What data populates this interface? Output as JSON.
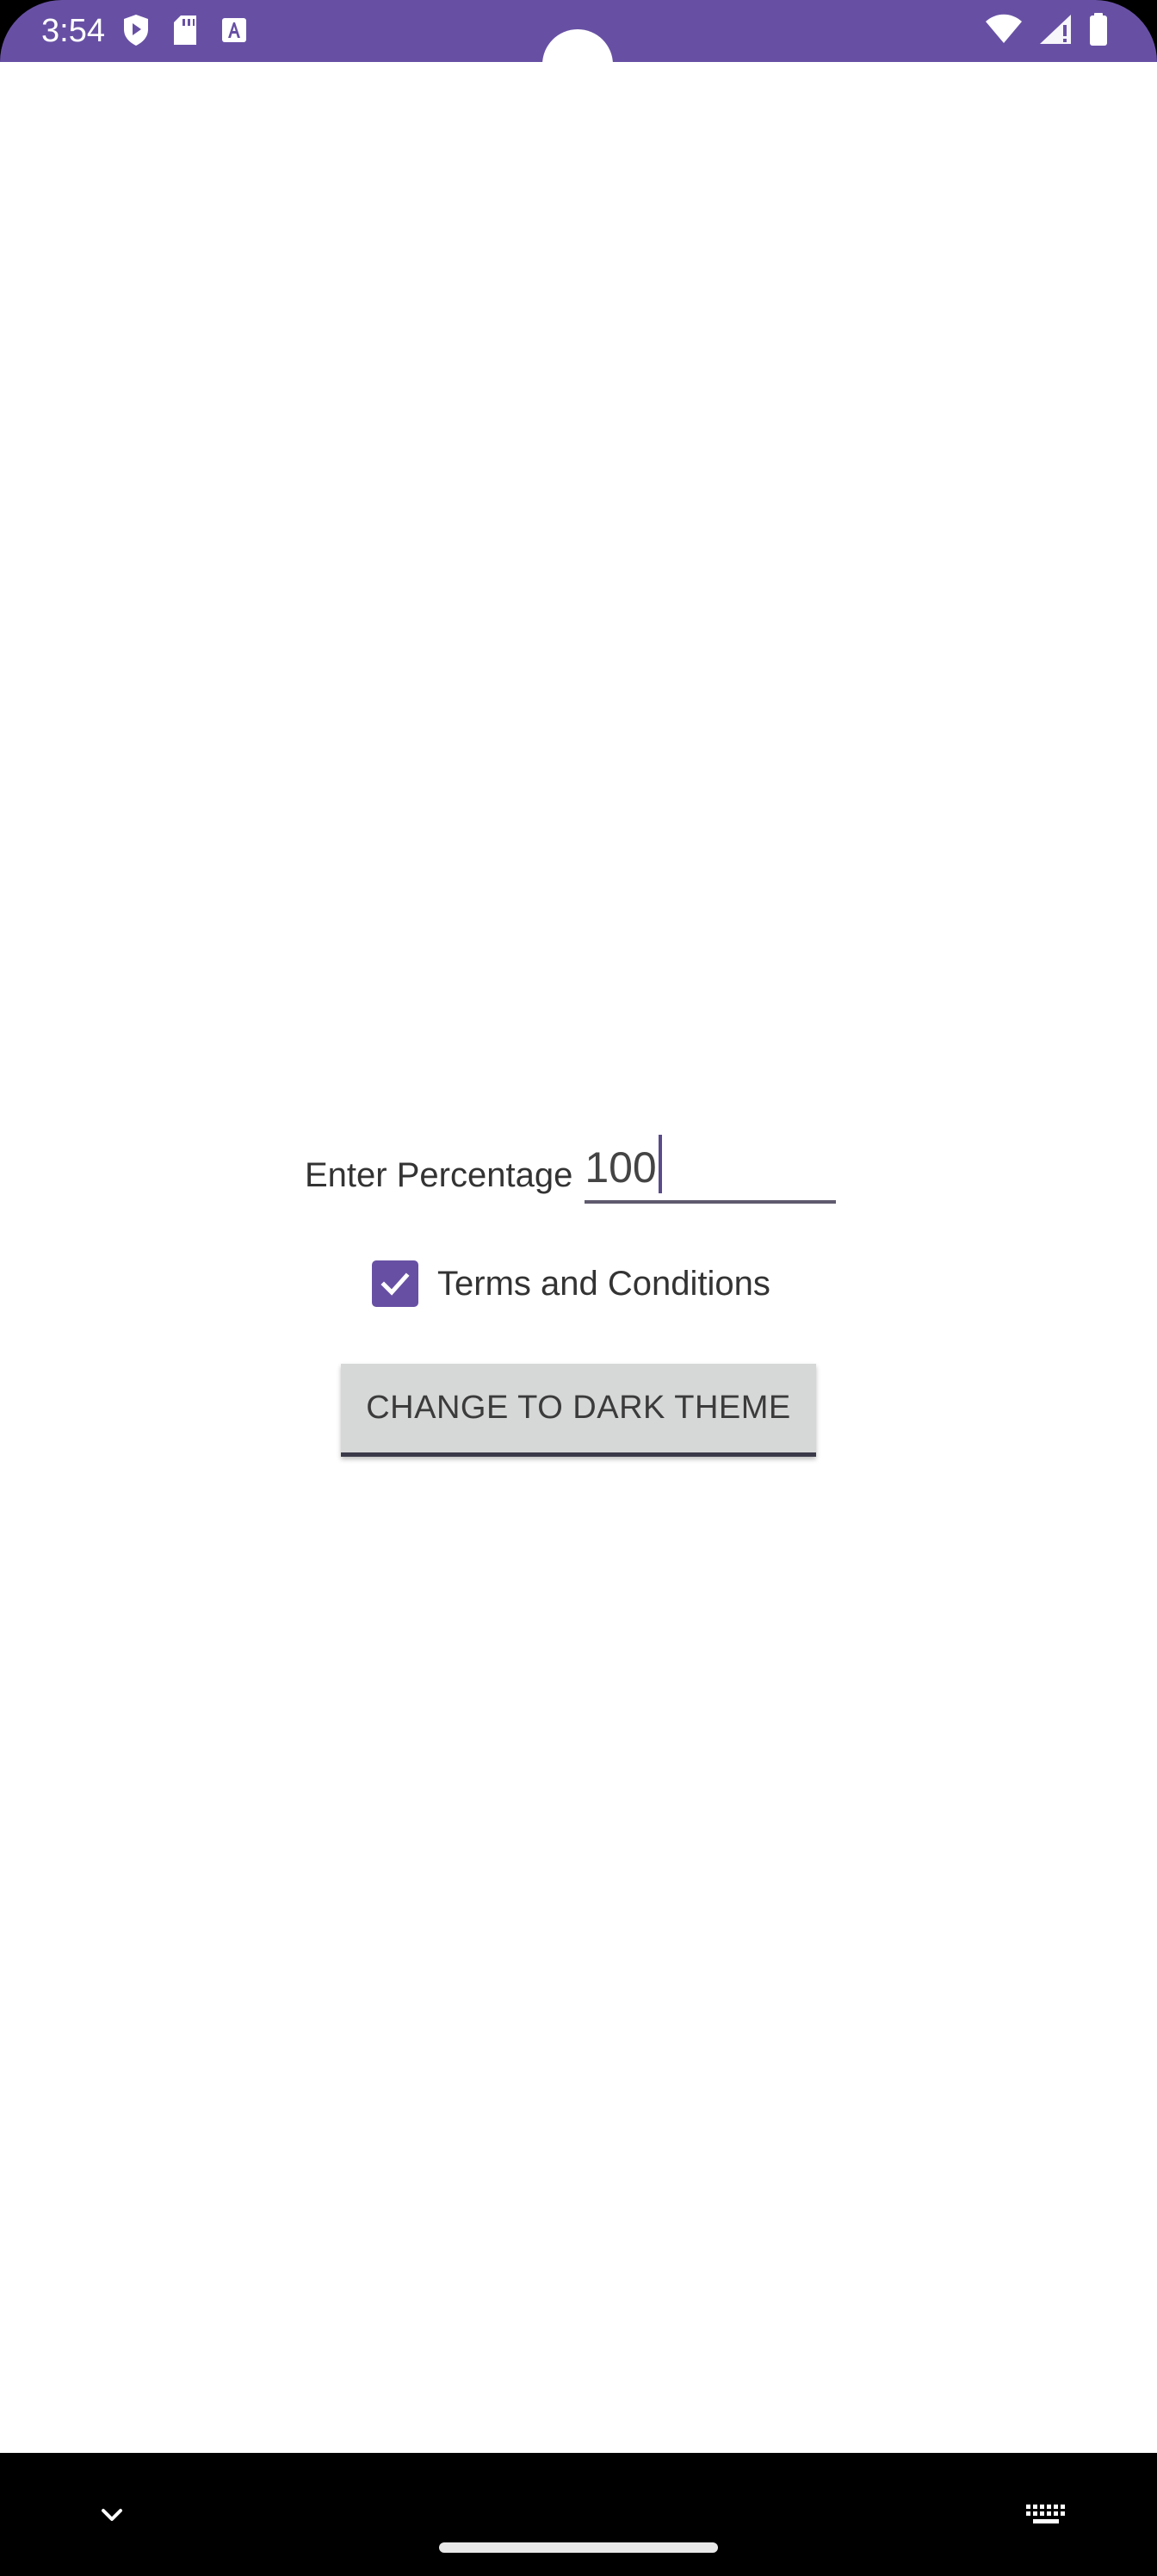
{
  "status_bar": {
    "time": "3:54",
    "left_icons": [
      "shield-play-icon",
      "sd-card-icon",
      "text-a-icon"
    ],
    "right_icons": [
      "wifi-icon",
      "signal-icon",
      "battery-icon"
    ],
    "background_color": "#6750A4"
  },
  "form": {
    "percentage_label": "Enter Percentage",
    "percentage_value": "100",
    "checkbox_checked": true,
    "checkbox_label": "Terms and Conditions",
    "theme_button_label": "CHANGE TO DARK THEME"
  },
  "nav_bar": {
    "back_icon": "chevron-down-icon",
    "keyboard_icon": "keyboard-icon"
  },
  "colors": {
    "accent": "#6750A4",
    "button_bg": "#d6d7d7"
  }
}
